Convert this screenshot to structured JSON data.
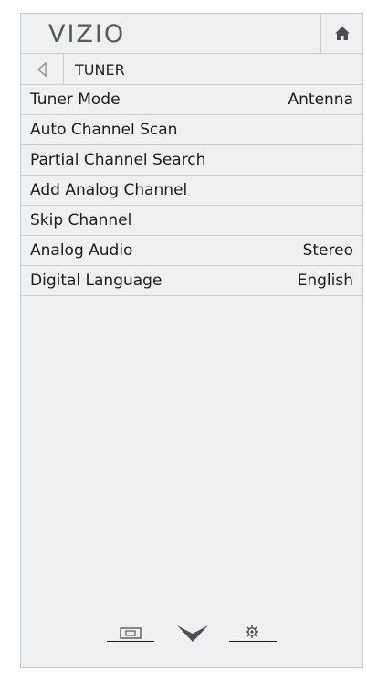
{
  "header": {
    "logo": "VIZIO",
    "home_icon": "home-icon"
  },
  "breadcrumb": {
    "back_icon": "back-arrow-icon",
    "label": "TUNER"
  },
  "menu": {
    "items": [
      {
        "label": "Tuner Mode",
        "value": "Antenna"
      },
      {
        "label": "Auto Channel Scan",
        "value": ""
      },
      {
        "label": "Partial Channel Search",
        "value": ""
      },
      {
        "label": "Add Analog Channel",
        "value": ""
      },
      {
        "label": "Skip Channel",
        "value": ""
      },
      {
        "label": "Analog Audio",
        "value": "Stereo"
      },
      {
        "label": "Digital Language",
        "value": "English"
      }
    ]
  },
  "footer": {
    "icons": [
      "wide-screen-icon",
      "vizio-v-icon",
      "settings-gear-icon"
    ]
  }
}
